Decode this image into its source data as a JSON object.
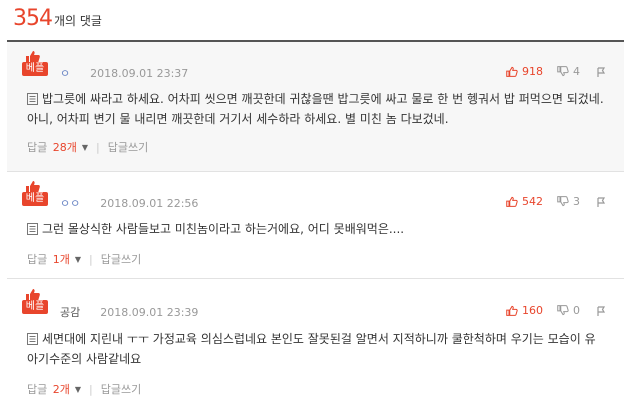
{
  "header": {
    "count": "354",
    "count_label": "개의 댓글"
  },
  "colors": {
    "accent": "#e8452c",
    "nick": "#6b86c5",
    "muted": "#999999"
  },
  "comments": [
    {
      "best_label": "베플",
      "nickname": "ㅇ",
      "datetime": "2018.09.01 23:37",
      "likes": "918",
      "dislikes": "4",
      "text": "밥그릇에 싸라고 하세요. 어차피 씻으면 깨끗한데 귀찮을땐 밥그릇에 싸고 물로 한 번 헹궈서 밥 퍼먹으면 되겄네. 아니, 어차피 변기 물 내리면 깨끗한데 거기서 세수하라 하세요. 별 미친 놈 다보겄네.",
      "reply_label": "답글",
      "reply_count": "28개",
      "write_reply": "답글쓰기"
    },
    {
      "best_label": "베플",
      "nickname": "ㅇㅇ",
      "datetime": "2018.09.01 22:56",
      "likes": "542",
      "dislikes": "3",
      "text": "그런 몰상식한 사람들보고 미친놈이라고 하는거에요, 어디 못배워먹은....",
      "reply_label": "답글",
      "reply_count": "1개",
      "write_reply": "답글쓰기"
    },
    {
      "best_label": "베플",
      "nickname": "공감",
      "datetime": "2018.09.01 23:39",
      "likes": "160",
      "dislikes": "0",
      "text": "세면대에 지린내 ㅜㅜ 가정교육 의심스럽네요 본인도 잘못된걸 알면서 지적하니까 쿨한척하며 우기는 모습이 유아기수준의 사람같네요",
      "reply_label": "답글",
      "reply_count": "2개",
      "write_reply": "답글쓰기"
    }
  ]
}
